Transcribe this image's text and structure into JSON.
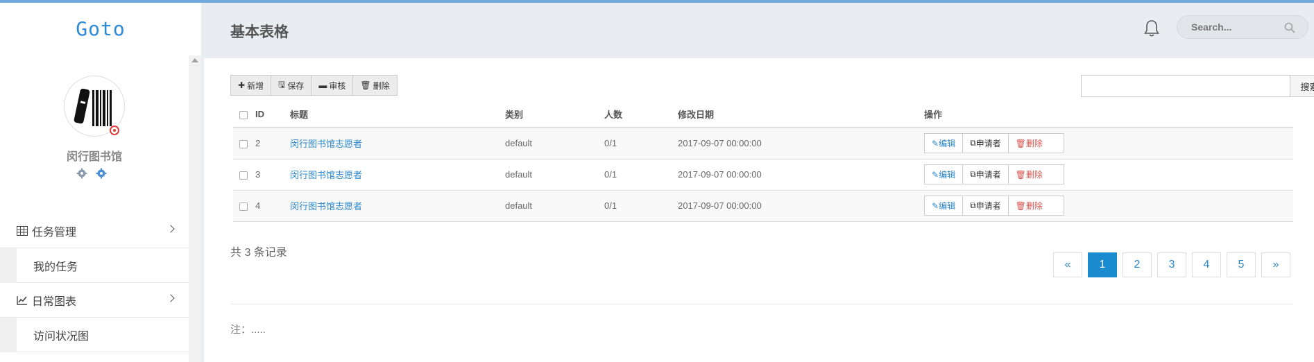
{
  "app": {
    "brand": "Goto"
  },
  "user": {
    "name": "闵行图书馆"
  },
  "sidebar": {
    "menu": [
      {
        "label": "任务管理",
        "icon": "table-icon",
        "children": [
          {
            "label": "我的任务"
          }
        ]
      },
      {
        "label": "日常图表",
        "icon": "line-chart-icon",
        "children": [
          {
            "label": "访问状况图"
          }
        ]
      }
    ]
  },
  "header": {
    "title": "基本表格",
    "search_placeholder": "Search..."
  },
  "toolbar": {
    "add": "新增",
    "save": "保存",
    "review": "审核",
    "delete": "删除"
  },
  "filter": {
    "button": "搜索",
    "value": ""
  },
  "table": {
    "headers": {
      "id": "ID",
      "title": "标题",
      "category": "类别",
      "count": "人数",
      "modified": "修改日期",
      "actions": "操作"
    },
    "rows": [
      {
        "id": "2",
        "title": "闵行图书馆志愿者",
        "category": "default",
        "count": "0/1",
        "modified": "2017-09-07 00:00:00"
      },
      {
        "id": "3",
        "title": "闵行图书馆志愿者",
        "category": "default",
        "count": "0/1",
        "modified": "2017-09-07 00:00:00"
      },
      {
        "id": "4",
        "title": "闵行图书馆志愿者",
        "category": "default",
        "count": "0/1",
        "modified": "2017-09-07 00:00:00"
      }
    ],
    "row_actions": {
      "edit": "编辑",
      "applicants": "申请者",
      "delete": "删除"
    }
  },
  "summary": {
    "total": "共 3 条记录"
  },
  "pagination": {
    "prev": "«",
    "pages": [
      "1",
      "2",
      "3",
      "4",
      "5"
    ],
    "next": "»",
    "current": "1"
  },
  "note": "注：.....",
  "colors": {
    "accent": "#1b8bd0",
    "link": "#2b87c9",
    "danger": "#d9534f",
    "brand": "#2e8ad8"
  }
}
